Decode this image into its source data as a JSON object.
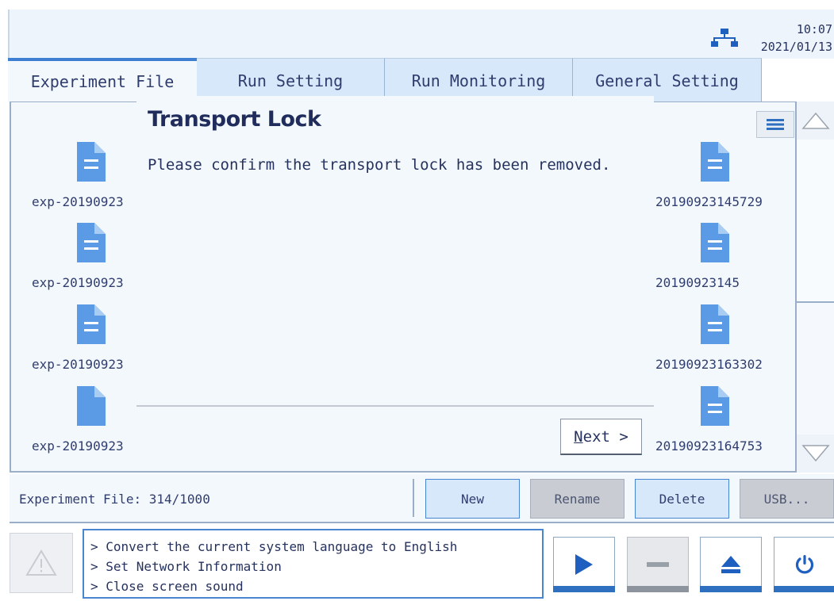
{
  "status": {
    "time": "10:07",
    "date": "2021/01/13",
    "network_icon": "network-icon"
  },
  "tabs": [
    {
      "label": "Experiment File",
      "active": true
    },
    {
      "label": "Run Setting",
      "active": false
    },
    {
      "label": "Run Monitoring",
      "active": false
    },
    {
      "label": "General Setting",
      "active": false
    }
  ],
  "files": {
    "left": [
      "exp-20190923",
      "exp-20190923",
      "exp-20190923",
      "exp-20190923"
    ],
    "right": [
      "20190923145729",
      "20190923145",
      "20190923163302",
      "20190923164753"
    ]
  },
  "dialog": {
    "title": "Transport Lock",
    "message": "Please confirm the transport lock has been removed.",
    "next_mnemonic": "N",
    "next_rest": "ext >"
  },
  "actionbar": {
    "count_text": "Experiment File: 314/1000",
    "new_label": "New",
    "rename_label": "Rename",
    "delete_label": "Delete",
    "usb_label": "USB..."
  },
  "messages": [
    "> Convert the current system language to English",
    "> Set Network Information",
    "> Close screen sound"
  ],
  "colors": {
    "accent": "#2e6fbf",
    "tab_bg": "#d7e8fb",
    "panel_bg": "#f3f8fd",
    "doc_icon": "#5b9be6"
  }
}
